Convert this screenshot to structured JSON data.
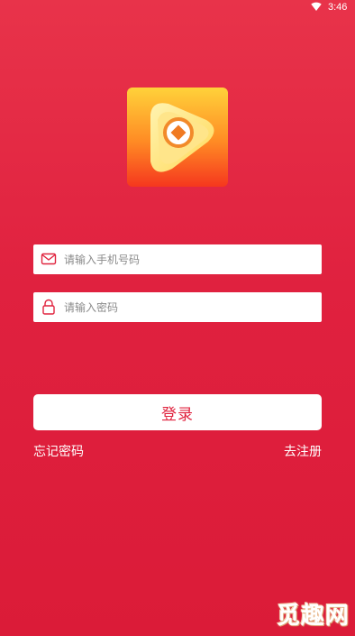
{
  "status_bar": {
    "time": "3:46",
    "icons": [
      "wifi-icon"
    ]
  },
  "app_logo": {
    "icon": "coin-play-logo-icon"
  },
  "login_form": {
    "phone": {
      "placeholder": "请输入手机号码",
      "value": "",
      "icon": "mail-icon"
    },
    "password": {
      "placeholder": "请输入密码",
      "value": "",
      "icon": "lock-icon"
    },
    "submit_label": "登录",
    "forgot_password_label": "忘记密码",
    "register_label": "去注册"
  },
  "watermark": {
    "text": "觅趣网"
  },
  "colors": {
    "background": "#e0213f",
    "accent": "#e0243f",
    "field_bg": "#ffffff"
  }
}
